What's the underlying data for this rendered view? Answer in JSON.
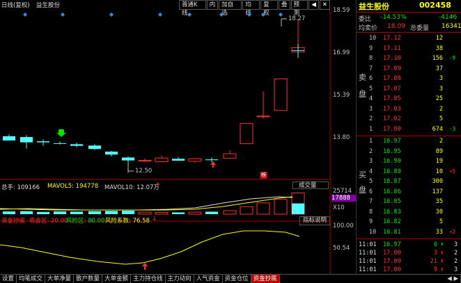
{
  "toolbar": {
    "left_label": "日线(复权)",
    "stock_name": "益生股份",
    "buttons": [
      "普通K线",
      "内",
      "加自选",
      "均线",
      "复权",
      "叠",
      "预测"
    ]
  },
  "price_axis": [
    "18.59",
    "16.99",
    "15.39",
    "13.80"
  ],
  "annotations": {
    "high": "18.27",
    "low": "12.50",
    "marker": "榜"
  },
  "chart_data": {
    "type": "candlestick",
    "candles": [
      {
        "open": 13.88,
        "high": 13.95,
        "low": 13.72,
        "close": 13.72
      },
      {
        "open": 13.85,
        "high": 13.92,
        "low": 13.42,
        "close": 13.65
      },
      {
        "open": 13.69,
        "high": 13.76,
        "low": 13.52,
        "close": 13.65
      },
      {
        "open": 13.62,
        "high": 13.68,
        "low": 13.57,
        "close": 13.6
      },
      {
        "open": 13.58,
        "high": 13.63,
        "low": 13.46,
        "close": 13.52
      },
      {
        "open": 13.53,
        "high": 13.58,
        "low": 13.36,
        "close": 13.4
      },
      {
        "open": 13.3,
        "high": 13.33,
        "low": 13.12,
        "close": 13.19
      },
      {
        "open": 13.08,
        "high": 13.12,
        "low": 12.5,
        "close": 12.97
      },
      {
        "open": 12.96,
        "high": 13.04,
        "low": 12.92,
        "close": 12.97
      },
      {
        "open": 12.92,
        "high": 13.16,
        "low": 12.89,
        "close": 13.06
      },
      {
        "open": 13.03,
        "high": 13.1,
        "low": 12.96,
        "close": 12.96
      },
      {
        "open": 12.94,
        "high": 13.03,
        "low": 12.88,
        "close": 13.03
      },
      {
        "open": 13.01,
        "high": 13.08,
        "low": 12.91,
        "close": 12.98
      },
      {
        "open": 13.05,
        "high": 13.36,
        "low": 13.04,
        "close": 13.22
      },
      {
        "open": 13.6,
        "high": 14.36,
        "low": 13.6,
        "close": 14.36
      },
      {
        "open": 14.63,
        "high": 15.57,
        "low": 14.54,
        "close": 14.64
      },
      {
        "open": 14.85,
        "high": 16.04,
        "low": 14.85,
        "close": 16.04
      },
      {
        "open": 17.05,
        "high": 18.27,
        "low": 17.05,
        "close": 17.22
      },
      {
        "open": 17.12,
        "high": 17.36,
        "low": 16.83,
        "close": 17.12
      }
    ]
  },
  "volume": {
    "header": "总手: 109166",
    "mavol5": "MAVOL5: 194778",
    "mavol10": "MAVOL10: 12.07万",
    "dropdown": "成交量",
    "axis": [
      "25714",
      "17888",
      "X10"
    ]
  },
  "indicator": {
    "name": "资金抄底",
    "opportunity": "机会区: 20.00",
    "risk": "风险区: 80.00",
    "risk_coef": "风险系数: 76.58",
    "button": "指标说明",
    "axis": [
      "100.00",
      "50.54"
    ]
  },
  "quote": {
    "name": "益生股份",
    "code": "002458",
    "ratio_label": "委比",
    "ratio": "-14.53%",
    "diff": "-4146",
    "avg_label": "均卖价",
    "avg": "18.09",
    "total_label": "总委量",
    "total": "16341",
    "sell_side": "卖",
    "sell_side2": "盘",
    "buy_side": "买",
    "buy_side2": "盘",
    "asks": [
      {
        "lvl": "10",
        "price": "17.12",
        "vol": "12",
        "chg": ""
      },
      {
        "lvl": "9",
        "price": "17.11",
        "vol": "38",
        "chg": ""
      },
      {
        "lvl": "8",
        "price": "17.10",
        "vol": "156",
        "chg": "-9"
      },
      {
        "lvl": "7",
        "price": "17.09",
        "vol": "37",
        "chg": ""
      },
      {
        "lvl": "6",
        "price": "17.08",
        "vol": "3",
        "chg": ""
      },
      {
        "lvl": "5",
        "price": "17.07",
        "vol": "3",
        "chg": ""
      },
      {
        "lvl": "4",
        "price": "17.05",
        "vol": "25",
        "chg": ""
      },
      {
        "lvl": "3",
        "price": "17.03",
        "vol": "2",
        "chg": ""
      },
      {
        "lvl": "2",
        "price": "17.02",
        "vol": "5",
        "chg": ""
      },
      {
        "lvl": "1",
        "price": "17.00",
        "vol": "674",
        "chg": "-3"
      }
    ],
    "bids": [
      {
        "lvl": "1",
        "price": "16.97",
        "vol": "2",
        "chg": ""
      },
      {
        "lvl": "2",
        "price": "16.95",
        "vol": "89",
        "chg": ""
      },
      {
        "lvl": "3",
        "price": "16.90",
        "vol": "19",
        "chg": ""
      },
      {
        "lvl": "4",
        "price": "16.88",
        "vol": "10",
        "chg": "+5"
      },
      {
        "lvl": "5",
        "price": "16.87",
        "vol": "300",
        "chg": ""
      },
      {
        "lvl": "6",
        "price": "16.86",
        "vol": "137",
        "chg": ""
      },
      {
        "lvl": "7",
        "price": "16.85",
        "vol": "35",
        "chg": ""
      },
      {
        "lvl": "8",
        "price": "16.83",
        "vol": "30",
        "chg": ""
      },
      {
        "lvl": "9",
        "price": "16.82",
        "vol": "5",
        "chg": ""
      },
      {
        "lvl": "10",
        "price": "16.81",
        "vol": "33",
        "chg": "+2"
      }
    ],
    "ticks": [
      {
        "time": "11:01",
        "price": "16.97",
        "vol": "6",
        "dir": "down",
        "n": "3"
      },
      {
        "time": "11:01",
        "price": "17.00",
        "vol": "3",
        "dir": "up",
        "n": "2"
      },
      {
        "time": "11:01",
        "price": "17.00",
        "vol": "21",
        "dir": "up",
        "n": "2"
      },
      {
        "time": "11:01",
        "price": "17.00",
        "vol": "9",
        "dir": "up",
        "n": "3"
      }
    ]
  },
  "tabs": [
    "设置",
    "均笔成交",
    "大单净量",
    "散户数量",
    "大单金额",
    "主力持仓线",
    "主力动向",
    "人气资金",
    "资金仓位",
    "资金抄底"
  ],
  "colors": {
    "up": "#ff3232",
    "down": "#54ffff",
    "yellow": "#ffff00",
    "green": "#00e400"
  }
}
